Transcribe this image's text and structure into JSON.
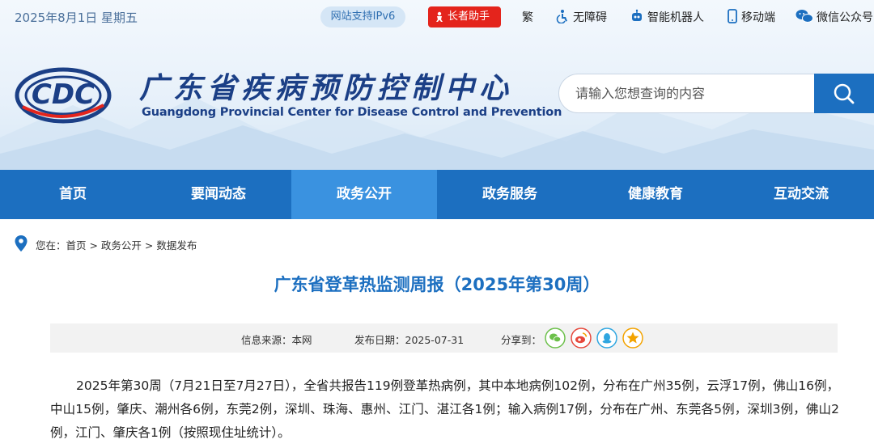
{
  "topbar": {
    "date": "2025年8月1日 星期五",
    "ipv6": "网站支持IPv6",
    "elder": "长者助手",
    "traditional": "繁",
    "accessibility": "无障碍",
    "robot": "智能机器人",
    "mobile": "移动端",
    "wechat": "微信公众号"
  },
  "brand": {
    "logo_text": "CDC",
    "cn_title": "广东省疾病预防控制中心",
    "en_title": "Guangdong Provincial Center for Disease Control and Prevention"
  },
  "search": {
    "placeholder": "请输入您想查询的内容"
  },
  "nav": {
    "items": [
      "首页",
      "要闻动态",
      "政务公开",
      "政务服务",
      "健康教育",
      "互动交流"
    ],
    "active_index": 2
  },
  "breadcrumb": "您在：首页 > 政务公开 > 数据发布",
  "article": {
    "title": "广东省登革热监测周报（2025年第30周）",
    "source_label": "信息来源：本网",
    "date_label": "发布日期：2025-07-31",
    "share_label": "分享到：",
    "share_icons": [
      "wechat-icon",
      "weibo-icon",
      "qq-icon",
      "qzone-icon"
    ],
    "body": "2025年第30周（7月21日至7月27日），全省共报告119例登革热病例，其中本地病例102例，分布在广州35例，云浮17例，佛山16例，中山15例，肇庆、潮州各6例，东莞2例，深圳、珠海、惠州、江门、湛江各1例；输入病例17例，分布在广州、东莞各5例，深圳3例，佛山2例，江门、肇庆各1例（按照现住址统计）。"
  },
  "colors": {
    "primary": "#1c6fc0",
    "nav_active": "#3a92e0",
    "elder_red": "#e4241c",
    "title_blue": "#1b3f86"
  }
}
